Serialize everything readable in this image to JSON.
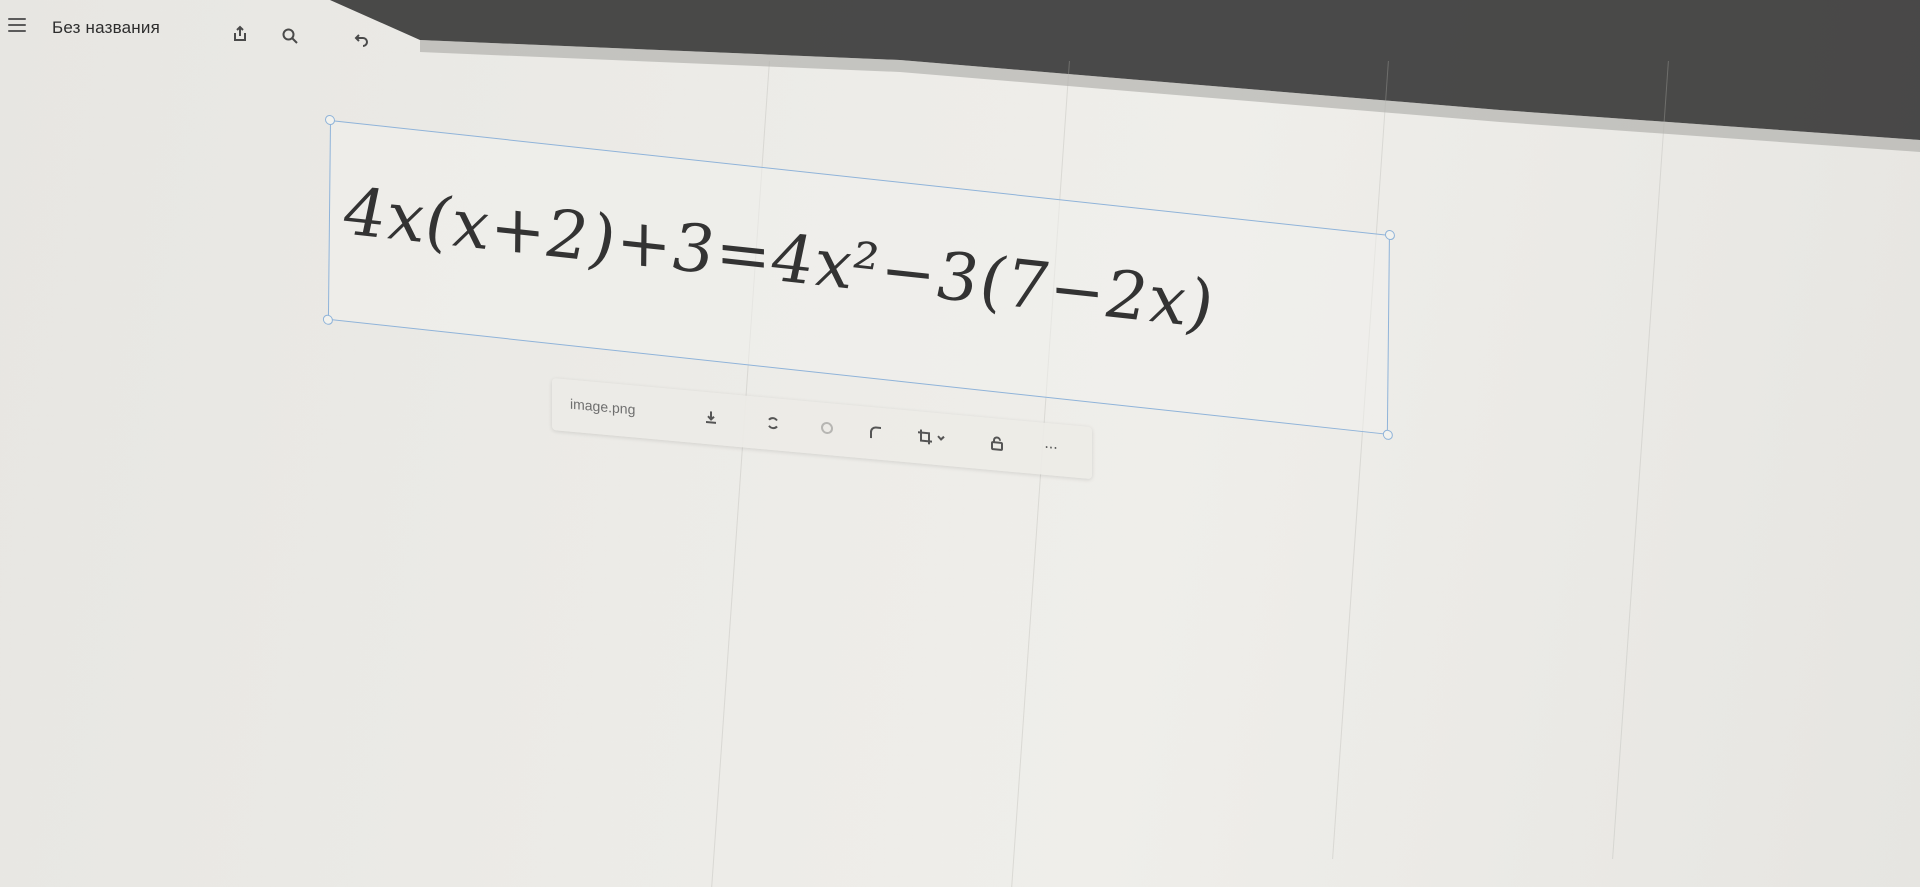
{
  "window": {
    "doc_title": "Без названия"
  },
  "toolbar": {
    "menu_icon": "hamburger-icon",
    "share_icon": "share-icon",
    "search_icon": "search-icon",
    "undo_icon": "undo-icon"
  },
  "image": {
    "equation": "4x(x+2)+3=4x²−3(7−2x)"
  },
  "image_toolbar": {
    "file_name": "image.png",
    "icons": [
      "download-icon",
      "replace-icon",
      "circle-icon",
      "corner-icon",
      "crop-icon",
      "lock-icon",
      "more-icon"
    ],
    "more_label": "..."
  },
  "colors": {
    "selection": "#8fb3d9",
    "text": "#333333",
    "background": "#ecebe7"
  }
}
